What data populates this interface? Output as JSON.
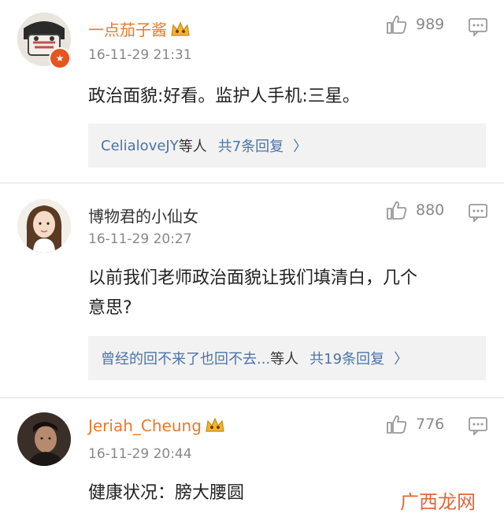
{
  "comments": [
    {
      "username": "一点茄子酱",
      "username_color": "#e87a2a",
      "timestamp": "16-11-29 21:31",
      "likes": "989",
      "content_lines": [
        "政治面貌:好看。监护人手机:三星。"
      ],
      "replies": {
        "users": "CelialoveJY",
        "suffix": "等人",
        "count": "共7条回复",
        "chevron": "〉"
      }
    },
    {
      "username": "博物君的小仙女",
      "username_color": "#333333",
      "timestamp": "16-11-29 20:27",
      "likes": "880",
      "content_lines": [
        "以前我们老师政治面貌让我们填清白，几个",
        "意思?"
      ],
      "replies": {
        "users": "曾经的回不来了也回不去...",
        "suffix": "等人",
        "count": "共19条回复",
        "chevron": "〉"
      }
    },
    {
      "username": "Jeriah_Cheung",
      "username_color": "#e87a2a",
      "timestamp": "16-11-29 20:44",
      "likes": "776",
      "content_lines": [
        "健康状况：膀大腰圆"
      ]
    }
  ],
  "icons": {
    "like": "thumbs-up-icon",
    "reply": "comment-icon",
    "vip": "crown-vip-icon"
  },
  "watermark": "广西龙网",
  "colors": {
    "link_blue": "#4a74a8",
    "orange": "#e87a2a",
    "reply_bg": "#f2f2f2"
  }
}
